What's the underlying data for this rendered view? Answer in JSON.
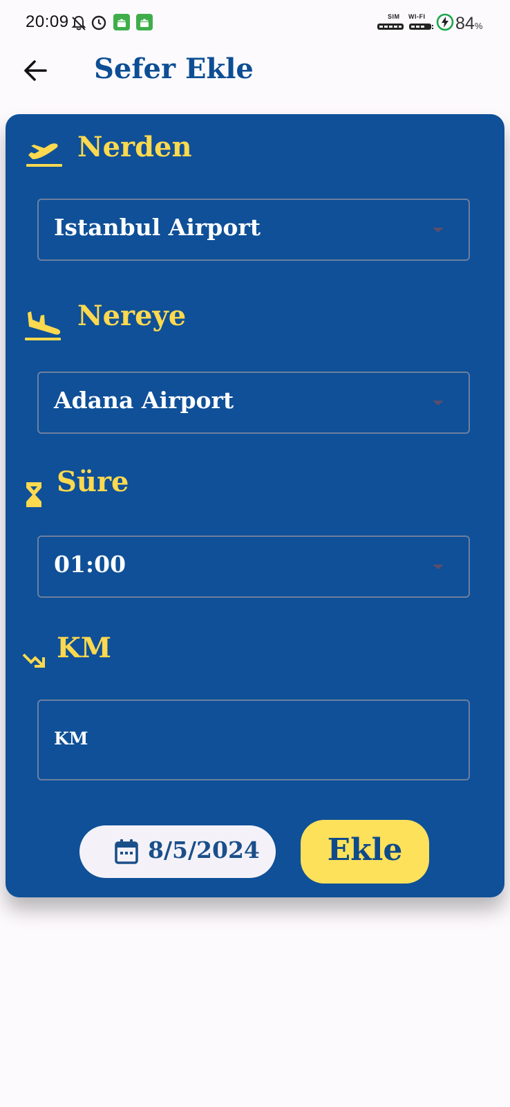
{
  "status_bar": {
    "time": "20:09",
    "sim_label": "SIM",
    "wifi_label": "WI-FI",
    "battery_level": "84",
    "battery_unit": "%",
    "icons": [
      "bell-off-icon",
      "clock-icon",
      "android-icon",
      "android-icon",
      "sim-signal-icon",
      "wifi-signal-icon",
      "charging-icon"
    ]
  },
  "header": {
    "back_icon": "arrow-left-icon",
    "title": "Sefer Ekle"
  },
  "form": {
    "from": {
      "label": "Nerden",
      "icon": "flight-takeoff-icon",
      "value": "Istanbul Airport"
    },
    "to": {
      "label": "Nereye",
      "icon": "flight-land-icon",
      "value": "Adana Airport"
    },
    "duration": {
      "label": "Süre",
      "icon": "hourglass-icon",
      "value": "01:00"
    },
    "km": {
      "label": "KM",
      "icon": "trending-down-icon",
      "placeholder": "KM",
      "value": ""
    },
    "date": {
      "icon": "calendar-icon",
      "value": "8/5/2024"
    },
    "submit_label": "Ekle"
  },
  "colors": {
    "card_bg": "#0f5098",
    "accent_yellow": "#fdd94f",
    "title_blue": "#0d4e94",
    "page_bg": "#fdfafd"
  }
}
